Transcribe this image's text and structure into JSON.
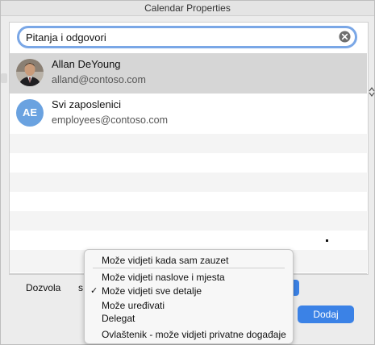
{
  "window": {
    "title": "Calendar Properties"
  },
  "search": {
    "value": "Pitanja i odgovori"
  },
  "results": [
    {
      "name": "Allan DeYoung",
      "email": "alland@contoso.com"
    },
    {
      "initials": "AE",
      "name": "Svi zaposlenici",
      "email": "employees@contoso.com"
    }
  ],
  "form": {
    "permission_label": "Dozvola",
    "s_label": "s",
    "add_label": "Dodaj"
  },
  "menu": {
    "items": [
      "Može vidjeti kada sam zauzet",
      "Može vidjeti naslove i mjesta",
      "Može vidjeti sve detalje",
      "Može uređivati",
      "Delegat",
      "Ovlaštenik - može vidjeti privatne događaje"
    ],
    "check_mark": "✓"
  },
  "colors": {
    "accent": "#3b82e6",
    "avatar_ae": "#6aa2e0",
    "selected_row": "#d6d6d6"
  }
}
